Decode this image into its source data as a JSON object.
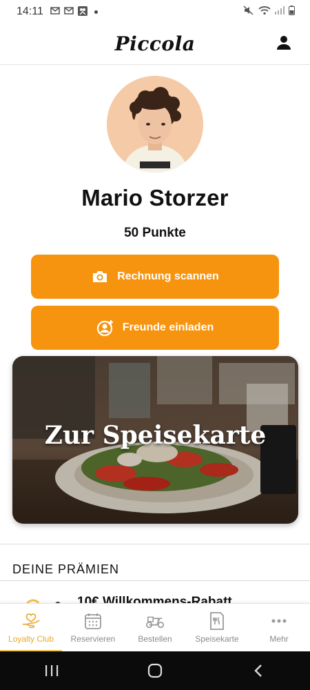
{
  "statusbar": {
    "time": "14:11"
  },
  "header": {
    "brand": "Piccola"
  },
  "profile": {
    "name": "Mario Storzer",
    "points": "50 Punkte"
  },
  "actions": {
    "scan_label": "Rechnung scannen",
    "invite_label": "Freunde einladen"
  },
  "menu_card": {
    "title": "Zur Speisekarte"
  },
  "rewards": {
    "section_title": "DEINE PRÄMIEN",
    "first_item_title": "10€ Willkommens-Rabatt"
  },
  "bottom_nav": {
    "items": [
      {
        "label": "Loyalty Club",
        "icon": "hand-heart-icon",
        "active": true
      },
      {
        "label": "Reservieren",
        "icon": "calendar-icon",
        "active": false
      },
      {
        "label": "Bestellen",
        "icon": "scooter-icon",
        "active": false
      },
      {
        "label": "Speisekarte",
        "icon": "menu-card-icon",
        "active": false
      },
      {
        "label": "Mehr",
        "icon": "more-dots-icon",
        "active": false
      }
    ]
  },
  "colors": {
    "accent": "#f7940f",
    "active_nav": "#e9a92a"
  }
}
